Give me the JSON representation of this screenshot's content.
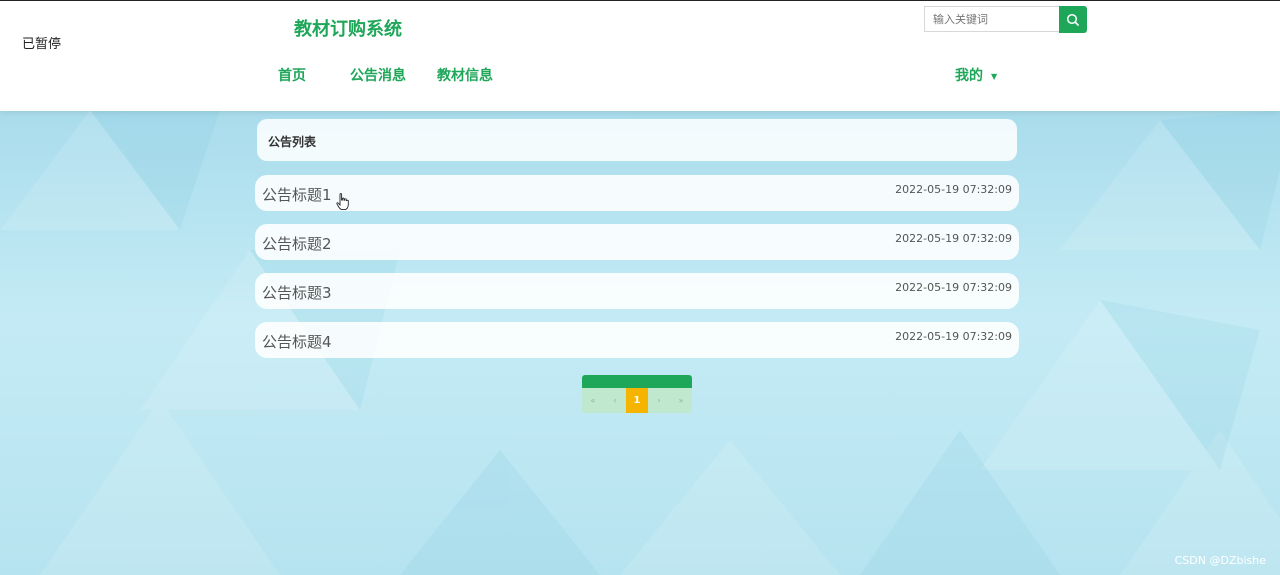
{
  "side_note": "已暂停",
  "site_title": "教材订购系统",
  "search": {
    "placeholder": "输入关键词"
  },
  "nav": {
    "items": [
      "首页",
      "公告消息",
      "教材信息"
    ],
    "my": "我的"
  },
  "panel_title": "公告列表",
  "notices": [
    {
      "title": "公告标题1",
      "time": "2022-05-19 07:32:09"
    },
    {
      "title": "公告标题2",
      "time": "2022-05-19 07:32:09"
    },
    {
      "title": "公告标题3",
      "time": "2022-05-19 07:32:09"
    },
    {
      "title": "公告标题4",
      "time": "2022-05-19 07:32:09"
    }
  ],
  "pager": {
    "first": "«",
    "prev": "‹",
    "current": "1",
    "next": "›",
    "last": "»"
  },
  "watermark": "CSDN @DZbishe",
  "colors": {
    "accent": "#1ea659",
    "active_page": "#f5b400"
  }
}
